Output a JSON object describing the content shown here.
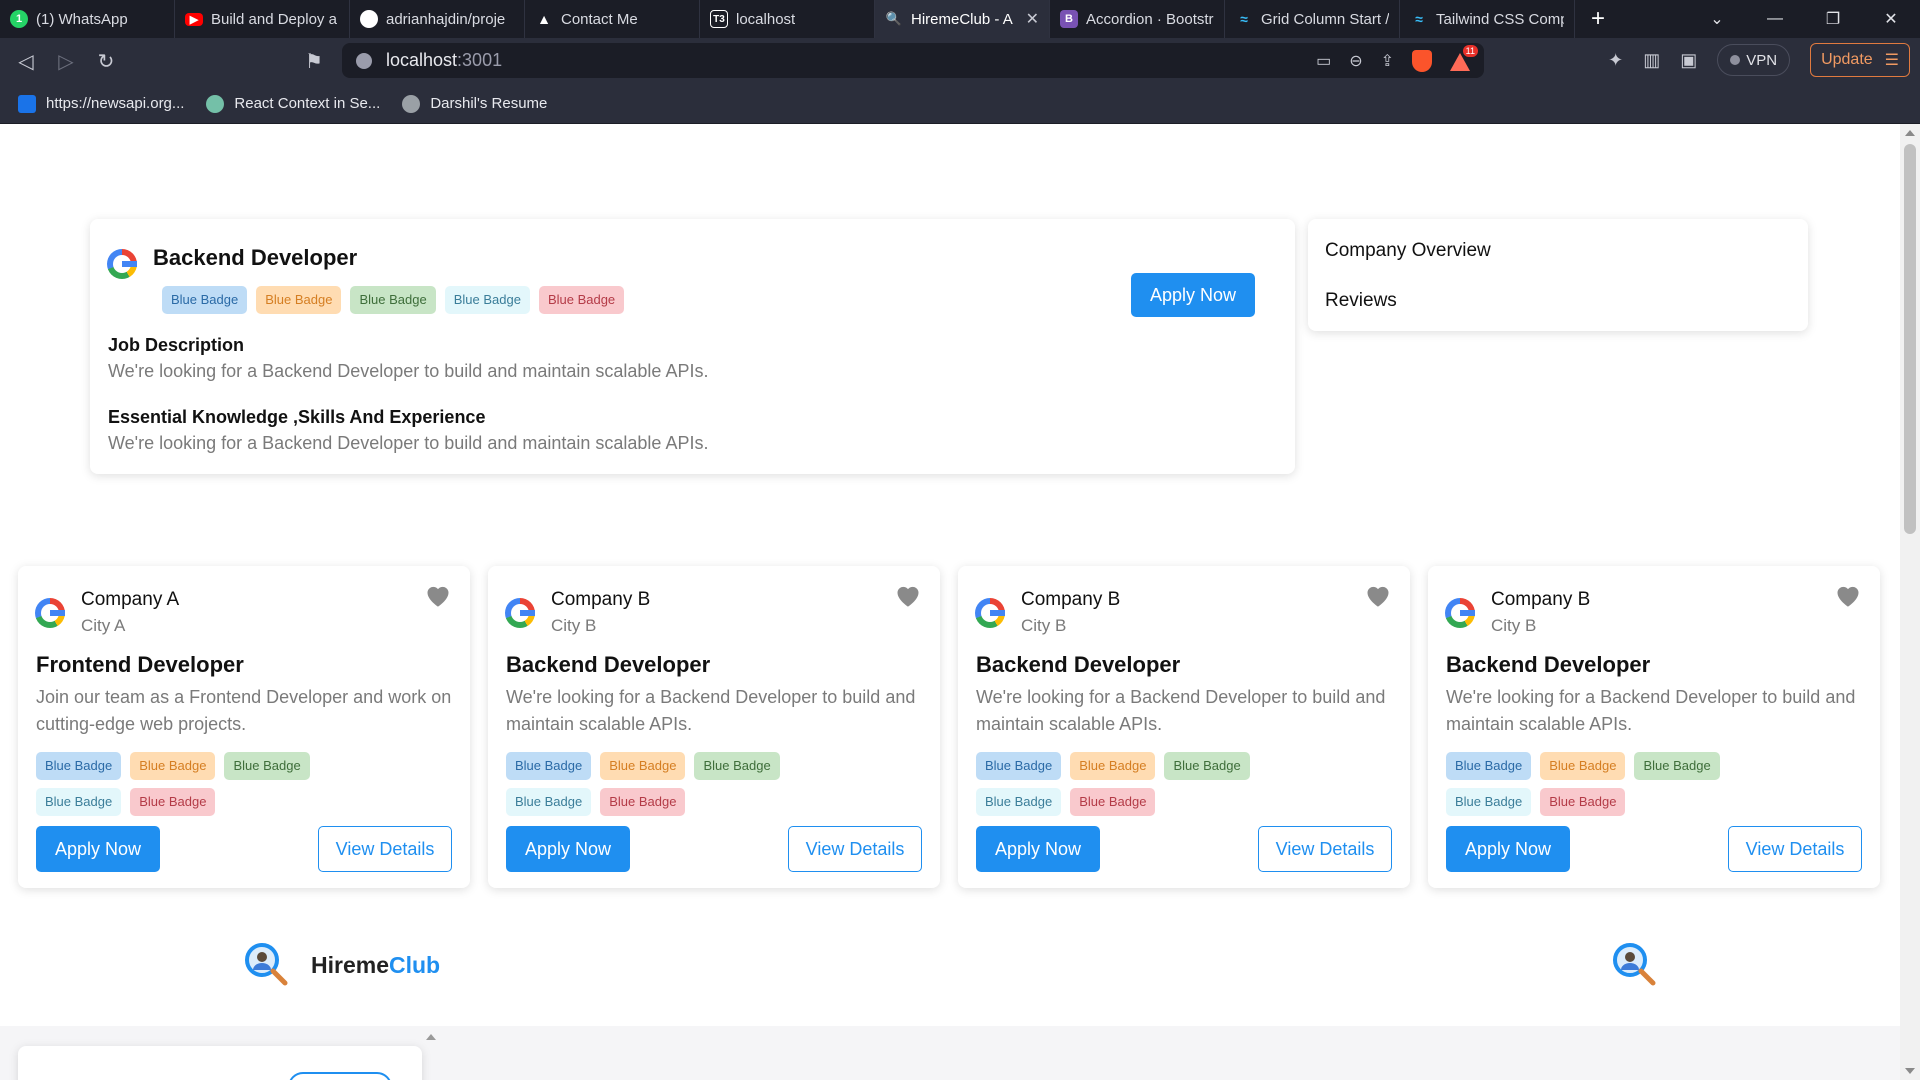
{
  "browser": {
    "tabs": [
      {
        "title": "(1) WhatsApp",
        "icon": "whatsapp-icon",
        "color": "#25d366"
      },
      {
        "title": "Build and Deploy a",
        "icon": "youtube-icon",
        "color": "#ff0000"
      },
      {
        "title": "adrianhajdin/proje",
        "icon": "github-icon",
        "color": "#ffffff"
      },
      {
        "title": "Contact Me",
        "icon": "triangle-icon",
        "color": "#ffffff"
      },
      {
        "title": "localhost",
        "icon": "t3-icon",
        "color": "#ffffff"
      },
      {
        "title": "HiremeClub - A",
        "icon": "magnifier-icon",
        "color": "#4f8ef7",
        "active": true
      },
      {
        "title": "Accordion · Bootstr",
        "icon": "bootstrap-icon",
        "color": "#7952b3"
      },
      {
        "title": "Grid Column Start /",
        "icon": "tailwind-icon",
        "color": "#38bdf8"
      },
      {
        "title": "Tailwind CSS Comp",
        "icon": "tailwind-icon",
        "color": "#38bdf8"
      }
    ],
    "url_host": "localhost",
    "url_port": ":3001",
    "vpn_label": "VPN",
    "update_label": "Update",
    "rewards_count": "11",
    "bookmarks": [
      {
        "label": "https://newsapi.org...",
        "color": "#1a73e8"
      },
      {
        "label": "React Context in Se...",
        "color": "#74c0a8"
      },
      {
        "label": "Darshil's Resume",
        "color": "#9aa0a6"
      }
    ]
  },
  "job_detail": {
    "title": "Backend Developer",
    "badges": [
      "Blue Badge",
      "Blue Badge",
      "Blue Badge",
      "Blue Badge",
      "Blue Badge"
    ],
    "apply_label": "Apply Now",
    "description_heading": "Job Description",
    "description_text": "We're looking for a Backend Developer to build and maintain scalable APIs.",
    "skills_heading": "Essential Knowledge ,Skills And Experience",
    "skills_text": "We're looking for a Backend Developer to build and maintain scalable APIs."
  },
  "side_menu": {
    "items": [
      "Company Overview",
      "Reviews"
    ]
  },
  "job_cards": [
    {
      "company": "Company A",
      "city": "City A",
      "title": "Frontend Developer",
      "description": "Join our team as a Frontend Developer and work on cutting-edge web projects.",
      "badges": [
        "Blue Badge",
        "Blue Badge",
        "Blue Badge",
        "Blue Badge",
        "Blue Badge"
      ],
      "apply_label": "Apply Now",
      "details_label": "View Details"
    },
    {
      "company": "Company B",
      "city": "City B",
      "title": "Backend Developer",
      "description": "We're looking for a Backend Developer to build and maintain scalable APIs.",
      "badges": [
        "Blue Badge",
        "Blue Badge",
        "Blue Badge",
        "Blue Badge",
        "Blue Badge"
      ],
      "apply_label": "Apply Now",
      "details_label": "View Details"
    },
    {
      "company": "Company B",
      "city": "City B",
      "title": "Backend Developer",
      "description": "We're looking for a Backend Developer to build and maintain scalable APIs.",
      "badges": [
        "Blue Badge",
        "Blue Badge",
        "Blue Badge",
        "Blue Badge",
        "Blue Badge"
      ],
      "apply_label": "Apply Now",
      "details_label": "View Details"
    },
    {
      "company": "Company B",
      "city": "City B",
      "title": "Backend Developer",
      "description": "We're looking for a Backend Developer to build and maintain scalable APIs.",
      "badges": [
        "Blue Badge",
        "Blue Badge",
        "Blue Badge",
        "Blue Badge",
        "Blue Badge"
      ],
      "apply_label": "Apply Now",
      "details_label": "View Details"
    }
  ],
  "footer": {
    "brand_part1": "Hireme",
    "brand_part2": "Club",
    "brand_color": "#1f8ff0"
  }
}
